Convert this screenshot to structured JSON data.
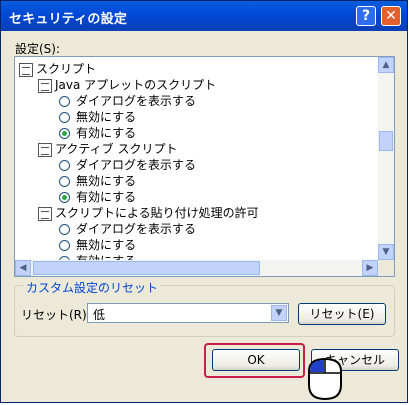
{
  "window": {
    "title": "セキュリティの設定",
    "help_glyph": "?",
    "close_glyph": "✕"
  },
  "settings_label": "設定(S):",
  "settings_rows": [
    {
      "type": "category",
      "text": "スクリプト"
    },
    {
      "type": "setting",
      "text": "Java アプレットのスクリプト"
    },
    {
      "type": "option",
      "text": "ダイアログを表示する",
      "selected": false
    },
    {
      "type": "option",
      "text": "無効にする",
      "selected": false
    },
    {
      "type": "option",
      "text": "有効にする",
      "selected": true
    },
    {
      "type": "setting",
      "text": "アクティブ スクリプト"
    },
    {
      "type": "option",
      "text": "ダイアログを表示する",
      "selected": false
    },
    {
      "type": "option",
      "text": "無効にする",
      "selected": false
    },
    {
      "type": "option",
      "text": "有効にする",
      "selected": true
    },
    {
      "type": "setting",
      "text": "スクリプトによる貼り付け処理の許可"
    },
    {
      "type": "option",
      "text": "ダイアログを表示する",
      "selected": false
    },
    {
      "type": "option",
      "text": "無効にする",
      "selected": false
    },
    {
      "type": "option",
      "text": "有効にする",
      "selected": false
    }
  ],
  "reset_group": {
    "title": "カスタム設定のリセット",
    "label": "リセット(R):",
    "selected_value": "低",
    "reset_button": "リセット(E)"
  },
  "buttons": {
    "ok": "OK",
    "cancel": "キャンセル"
  },
  "colors": {
    "title_bar": "#0048d8",
    "focus_highlight": "#cc1d4a",
    "group_title": "#0046d5"
  }
}
